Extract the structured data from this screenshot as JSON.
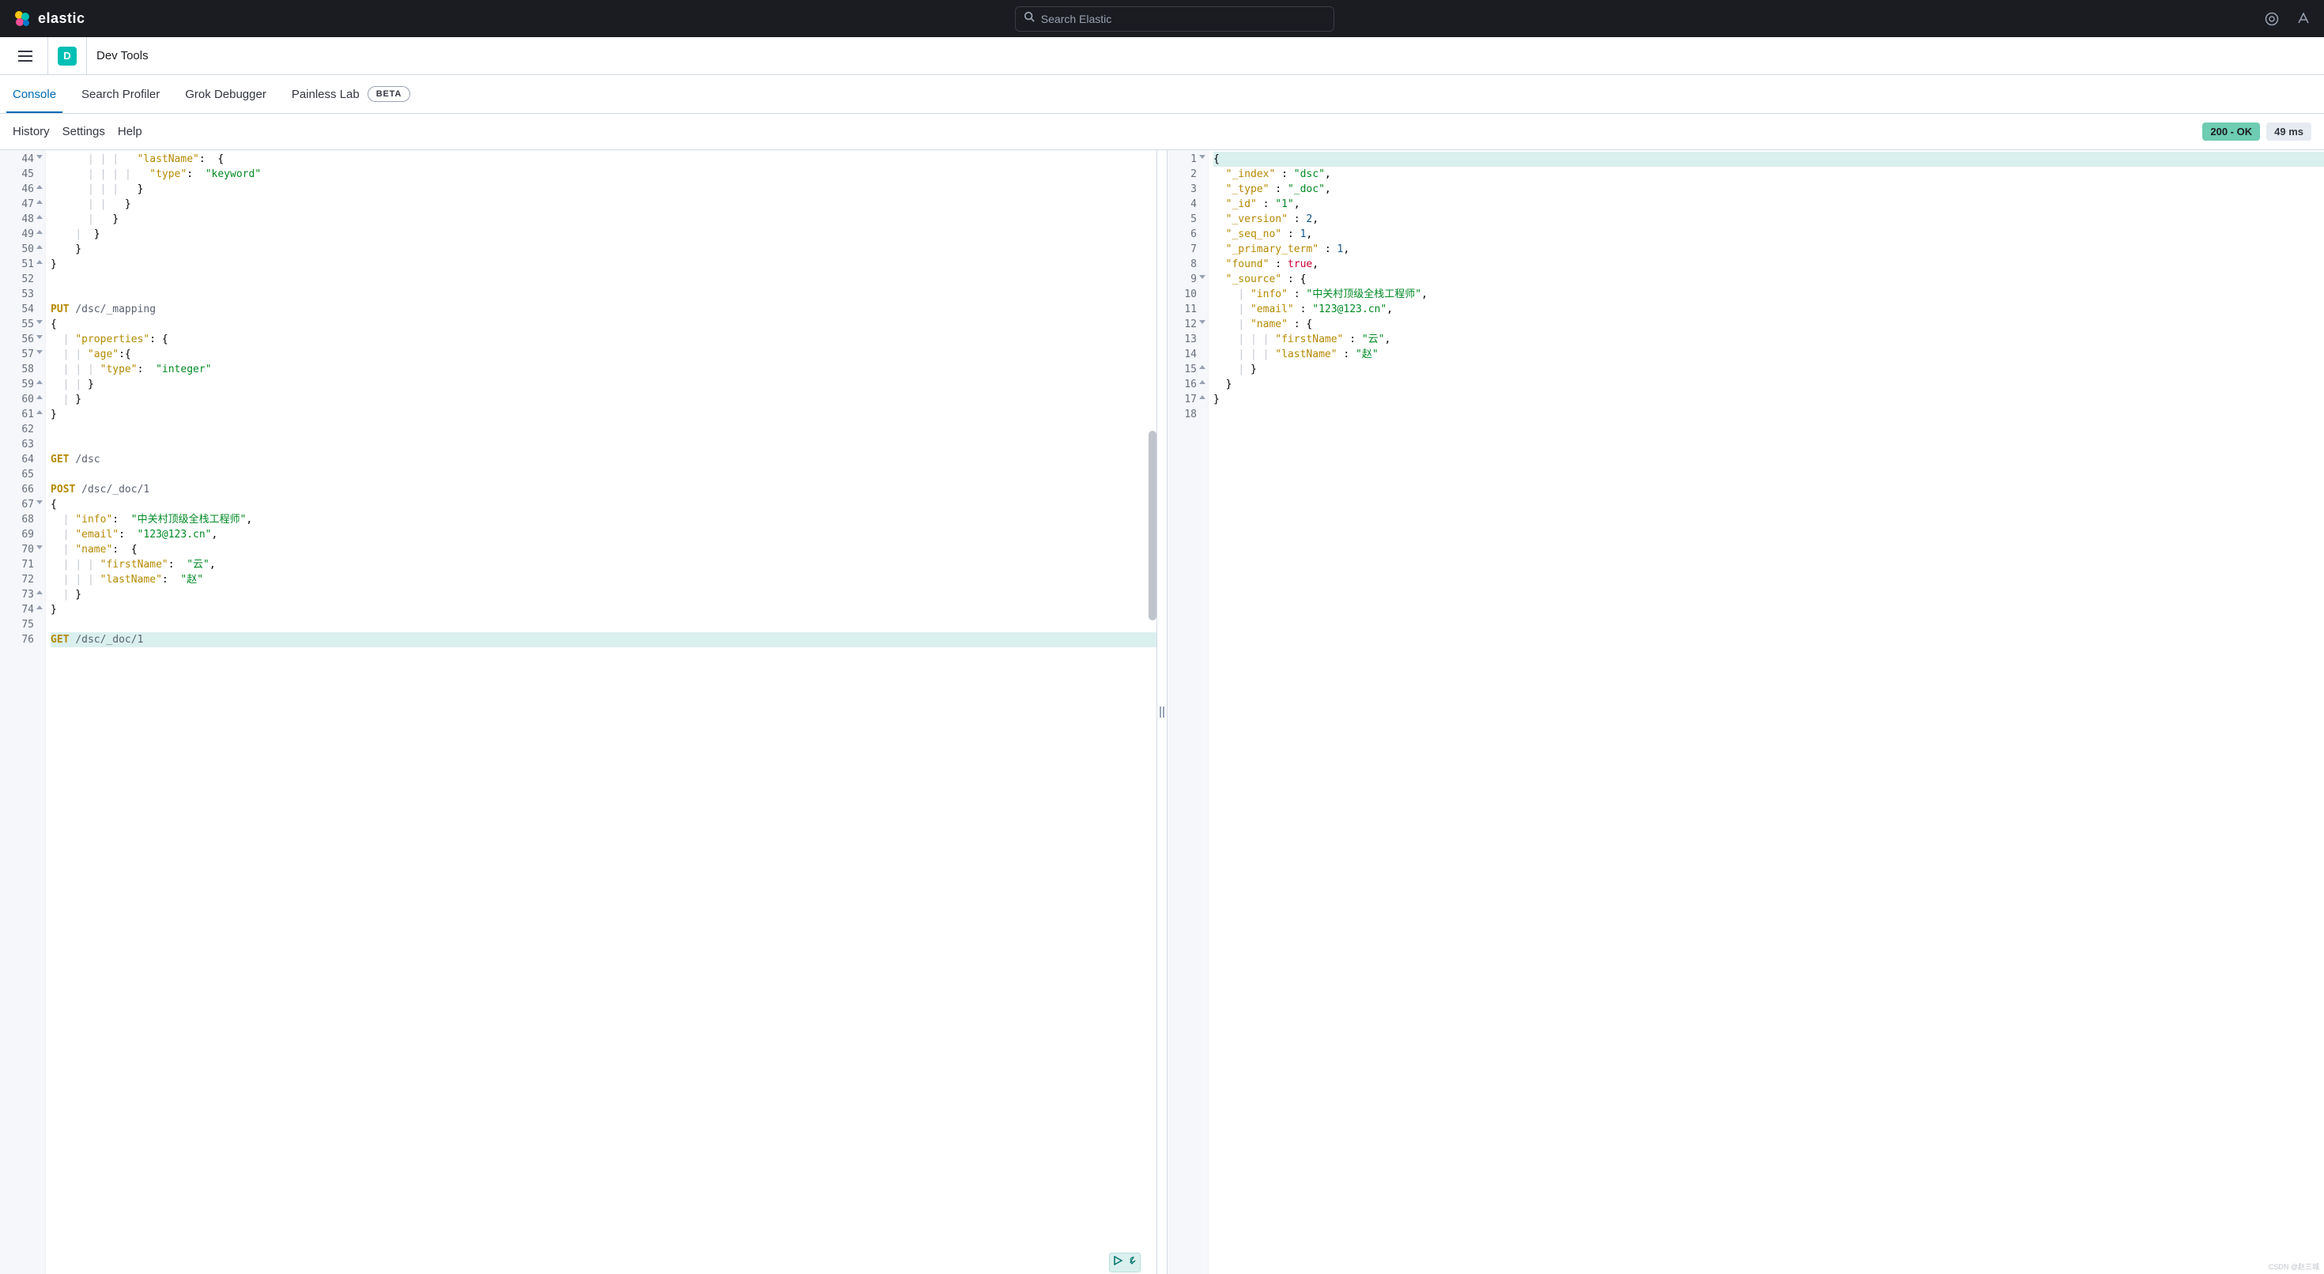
{
  "header": {
    "brand": "elastic",
    "search_placeholder": "Search Elastic"
  },
  "breadcrumb": {
    "badge": "D",
    "page": "Dev Tools"
  },
  "tabs": {
    "console": "Console",
    "profiler": "Search Profiler",
    "grok": "Grok Debugger",
    "painless": "Painless Lab",
    "beta": "BETA"
  },
  "toolbar": {
    "history": "History",
    "settings": "Settings",
    "help": "Help",
    "status": "200 - OK",
    "time": "49 ms"
  },
  "editor_left": {
    "lines": [
      {
        "n": "44",
        "a": "down",
        "t": [
          "      ",
          "|",
          " ",
          "|",
          " ",
          "|",
          "   ",
          [
            "key",
            "\"lastName\""
          ],
          ":",
          "  {"
        ]
      },
      {
        "n": "45",
        "a": "",
        "t": [
          "      ",
          "|",
          " ",
          "|",
          " ",
          "|",
          " ",
          "|",
          "   ",
          [
            "key",
            "\"type\""
          ],
          ":",
          "  ",
          [
            "str",
            "\"keyword\""
          ]
        ]
      },
      {
        "n": "46",
        "a": "up",
        "t": [
          "      ",
          "|",
          " ",
          "|",
          " ",
          "|",
          "   }"
        ]
      },
      {
        "n": "47",
        "a": "up",
        "t": [
          "      ",
          "|",
          " ",
          "|",
          "   }"
        ]
      },
      {
        "n": "48",
        "a": "up",
        "t": [
          "      ",
          "|",
          "   }"
        ]
      },
      {
        "n": "49",
        "a": "up",
        "t": [
          "    ",
          "|",
          "  }"
        ]
      },
      {
        "n": "50",
        "a": "up",
        "t": [
          "    }"
        ]
      },
      {
        "n": "51",
        "a": "up",
        "t": [
          "}"
        ]
      },
      {
        "n": "52",
        "a": "",
        "t": [
          ""
        ]
      },
      {
        "n": "53",
        "a": "",
        "t": [
          ""
        ]
      },
      {
        "n": "54",
        "a": "",
        "t": [
          [
            "method-put",
            "PUT"
          ],
          " ",
          [
            "path",
            "/dsc/_mapping"
          ]
        ]
      },
      {
        "n": "55",
        "a": "down",
        "t": [
          "{"
        ]
      },
      {
        "n": "56",
        "a": "down",
        "t": [
          "  ",
          "|",
          " ",
          [
            "key",
            "\"properties\""
          ],
          ":",
          " {"
        ]
      },
      {
        "n": "57",
        "a": "down",
        "t": [
          "  ",
          "|",
          " ",
          "|",
          " ",
          [
            "key",
            "\"age\""
          ],
          ":",
          "{"
        ]
      },
      {
        "n": "58",
        "a": "",
        "t": [
          "  ",
          "|",
          " ",
          "|",
          " ",
          "|",
          " ",
          [
            "key",
            "\"type\""
          ],
          ":",
          "  ",
          [
            "str",
            "\"integer\""
          ]
        ]
      },
      {
        "n": "59",
        "a": "up",
        "t": [
          "  ",
          "|",
          " ",
          "|",
          " }"
        ]
      },
      {
        "n": "60",
        "a": "up",
        "t": [
          "  ",
          "|",
          " }"
        ]
      },
      {
        "n": "61",
        "a": "up",
        "t": [
          "}"
        ]
      },
      {
        "n": "62",
        "a": "",
        "t": [
          ""
        ]
      },
      {
        "n": "63",
        "a": "",
        "t": [
          ""
        ]
      },
      {
        "n": "64",
        "a": "",
        "t": [
          [
            "method-get",
            "GET"
          ],
          " ",
          [
            "path",
            "/dsc"
          ]
        ]
      },
      {
        "n": "65",
        "a": "",
        "t": [
          ""
        ]
      },
      {
        "n": "66",
        "a": "",
        "t": [
          [
            "method-post",
            "POST"
          ],
          " ",
          [
            "path",
            "/dsc/_doc/1"
          ]
        ]
      },
      {
        "n": "67",
        "a": "down",
        "t": [
          "{"
        ]
      },
      {
        "n": "68",
        "a": "",
        "t": [
          "  ",
          "|",
          " ",
          [
            "key",
            "\"info\""
          ],
          ":",
          "  ",
          [
            "str",
            "\"中关村顶级全栈工程师\""
          ],
          ","
        ]
      },
      {
        "n": "69",
        "a": "",
        "t": [
          "  ",
          "|",
          " ",
          [
            "key",
            "\"email\""
          ],
          ":",
          "  ",
          [
            "str",
            "\"123@123.cn\""
          ],
          ","
        ]
      },
      {
        "n": "70",
        "a": "down",
        "t": [
          "  ",
          "|",
          " ",
          [
            "key",
            "\"name\""
          ],
          ":",
          "  {"
        ]
      },
      {
        "n": "71",
        "a": "",
        "t": [
          "  ",
          "|",
          " ",
          "|",
          " ",
          "|",
          " ",
          [
            "key",
            "\"firstName\""
          ],
          ":",
          "  ",
          [
            "str",
            "\"云\""
          ],
          ","
        ]
      },
      {
        "n": "72",
        "a": "",
        "t": [
          "  ",
          "|",
          " ",
          "|",
          " ",
          "|",
          " ",
          [
            "key",
            "\"lastName\""
          ],
          ":",
          "  ",
          [
            "str",
            "\"赵\""
          ]
        ]
      },
      {
        "n": "73",
        "a": "up",
        "t": [
          "  ",
          "|",
          " }"
        ]
      },
      {
        "n": "74",
        "a": "up",
        "t": [
          "}"
        ]
      },
      {
        "n": "75",
        "a": "",
        "t": [
          ""
        ]
      },
      {
        "n": "76",
        "a": "",
        "hl": true,
        "t": [
          [
            "method-get",
            "GET"
          ],
          " ",
          [
            "path",
            "/dsc/_doc/1"
          ]
        ]
      }
    ]
  },
  "editor_right": {
    "lines": [
      {
        "n": "1",
        "a": "down",
        "hl": true,
        "t": [
          "{"
        ]
      },
      {
        "n": "2",
        "a": "",
        "t": [
          "  ",
          [
            "key",
            "\"_index\""
          ],
          " : ",
          [
            "str",
            "\"dsc\""
          ],
          ","
        ]
      },
      {
        "n": "3",
        "a": "",
        "t": [
          "  ",
          [
            "key",
            "\"_type\""
          ],
          " : ",
          [
            "str",
            "\"_doc\""
          ],
          ","
        ]
      },
      {
        "n": "4",
        "a": "",
        "t": [
          "  ",
          [
            "key",
            "\"_id\""
          ],
          " : ",
          [
            "str",
            "\"1\""
          ],
          ","
        ]
      },
      {
        "n": "5",
        "a": "",
        "t": [
          "  ",
          [
            "key",
            "\"_version\""
          ],
          " : ",
          [
            "num",
            "2"
          ],
          ","
        ]
      },
      {
        "n": "6",
        "a": "",
        "t": [
          "  ",
          [
            "key",
            "\"_seq_no\""
          ],
          " : ",
          [
            "num",
            "1"
          ],
          ","
        ]
      },
      {
        "n": "7",
        "a": "",
        "t": [
          "  ",
          [
            "key",
            "\"_primary_term\""
          ],
          " : ",
          [
            "num",
            "1"
          ],
          ","
        ]
      },
      {
        "n": "8",
        "a": "",
        "t": [
          "  ",
          [
            "key",
            "\"found\""
          ],
          " : ",
          [
            "bool",
            "true"
          ],
          ","
        ]
      },
      {
        "n": "9",
        "a": "down",
        "t": [
          "  ",
          [
            "key",
            "\"_source\""
          ],
          " : {"
        ]
      },
      {
        "n": "10",
        "a": "",
        "t": [
          "    ",
          "|",
          " ",
          [
            "key",
            "\"info\""
          ],
          " : ",
          [
            "str",
            "\"中关村顶级全栈工程师\""
          ],
          ","
        ]
      },
      {
        "n": "11",
        "a": "",
        "t": [
          "    ",
          "|",
          " ",
          [
            "key",
            "\"email\""
          ],
          " : ",
          [
            "str",
            "\"123@123.cn\""
          ],
          ","
        ]
      },
      {
        "n": "12",
        "a": "down",
        "t": [
          "    ",
          "|",
          " ",
          [
            "key",
            "\"name\""
          ],
          " : {"
        ]
      },
      {
        "n": "13",
        "a": "",
        "t": [
          "    ",
          "|",
          " ",
          "|",
          " ",
          "|",
          " ",
          [
            "key",
            "\"firstName\""
          ],
          " : ",
          [
            "str",
            "\"云\""
          ],
          ","
        ]
      },
      {
        "n": "14",
        "a": "",
        "t": [
          "    ",
          "|",
          " ",
          "|",
          " ",
          "|",
          " ",
          [
            "key",
            "\"lastName\""
          ],
          " : ",
          [
            "str",
            "\"赵\""
          ]
        ]
      },
      {
        "n": "15",
        "a": "up",
        "t": [
          "    ",
          "|",
          " }"
        ]
      },
      {
        "n": "16",
        "a": "up",
        "t": [
          "  }"
        ]
      },
      {
        "n": "17",
        "a": "up",
        "t": [
          "}"
        ]
      },
      {
        "n": "18",
        "a": "",
        "t": [
          ""
        ]
      }
    ]
  },
  "footer_mark": "CSDN @赵三城"
}
